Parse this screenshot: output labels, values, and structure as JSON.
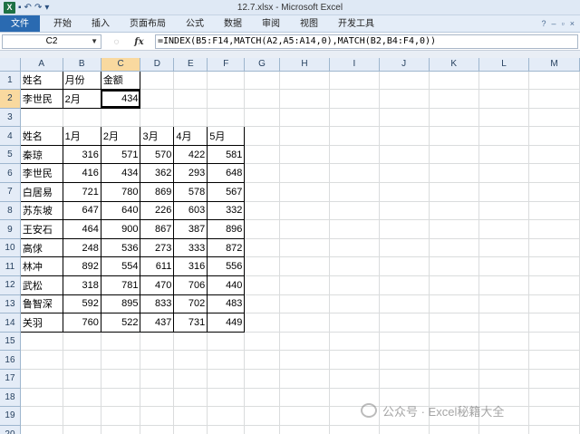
{
  "window": {
    "title": "12.7.xlsx - Microsoft Excel",
    "quick_access": [
      "undo-arrow",
      "redo-arrow"
    ]
  },
  "ribbon": {
    "tabs": [
      "文件",
      "开始",
      "插入",
      "页面布局",
      "公式",
      "数据",
      "审阅",
      "视图",
      "开发工具"
    ]
  },
  "formula_bar": {
    "name_box": "C2",
    "fx_label": "fx",
    "formula": "=INDEX(B5:F14,MATCH(A2,A5:A14,0),MATCH(B2,B4:F4,0))"
  },
  "columns": [
    "A",
    "B",
    "C",
    "D",
    "E",
    "F",
    "G",
    "H",
    "I",
    "J",
    "K",
    "L",
    "M"
  ],
  "selected_cell": {
    "column": "C",
    "row": 2
  },
  "lookup": {
    "headers": [
      "姓名",
      "月份",
      "金额"
    ],
    "name": "李世民",
    "month": "2月",
    "amount": "434"
  },
  "table": {
    "headers": [
      "姓名",
      "1月",
      "2月",
      "3月",
      "4月",
      "5月"
    ],
    "rows": [
      {
        "name": "秦琼",
        "values": [
          "316",
          "571",
          "570",
          "422",
          "581"
        ]
      },
      {
        "name": "李世民",
        "values": [
          "416",
          "434",
          "362",
          "293",
          "648"
        ]
      },
      {
        "name": "白居易",
        "values": [
          "721",
          "780",
          "869",
          "578",
          "567"
        ]
      },
      {
        "name": "苏东坡",
        "values": [
          "647",
          "640",
          "226",
          "603",
          "332"
        ]
      },
      {
        "name": "王安石",
        "values": [
          "464",
          "900",
          "867",
          "387",
          "896"
        ]
      },
      {
        "name": "高俅",
        "values": [
          "248",
          "536",
          "273",
          "333",
          "872"
        ]
      },
      {
        "name": "林冲",
        "values": [
          "892",
          "554",
          "611",
          "316",
          "556"
        ]
      },
      {
        "name": "武松",
        "values": [
          "318",
          "781",
          "470",
          "706",
          "440"
        ]
      },
      {
        "name": "鲁智深",
        "values": [
          "592",
          "895",
          "833",
          "702",
          "483"
        ]
      },
      {
        "name": "关羽",
        "values": [
          "760",
          "522",
          "437",
          "731",
          "449"
        ]
      }
    ]
  },
  "row_numbers": [
    "1",
    "2",
    "3",
    "4",
    "5",
    "6",
    "7",
    "8",
    "9",
    "10",
    "11",
    "12",
    "13",
    "14",
    "15",
    "16",
    "17",
    "18",
    "19",
    "20"
  ],
  "watermark": "公众号 · Excel秘籍大全"
}
